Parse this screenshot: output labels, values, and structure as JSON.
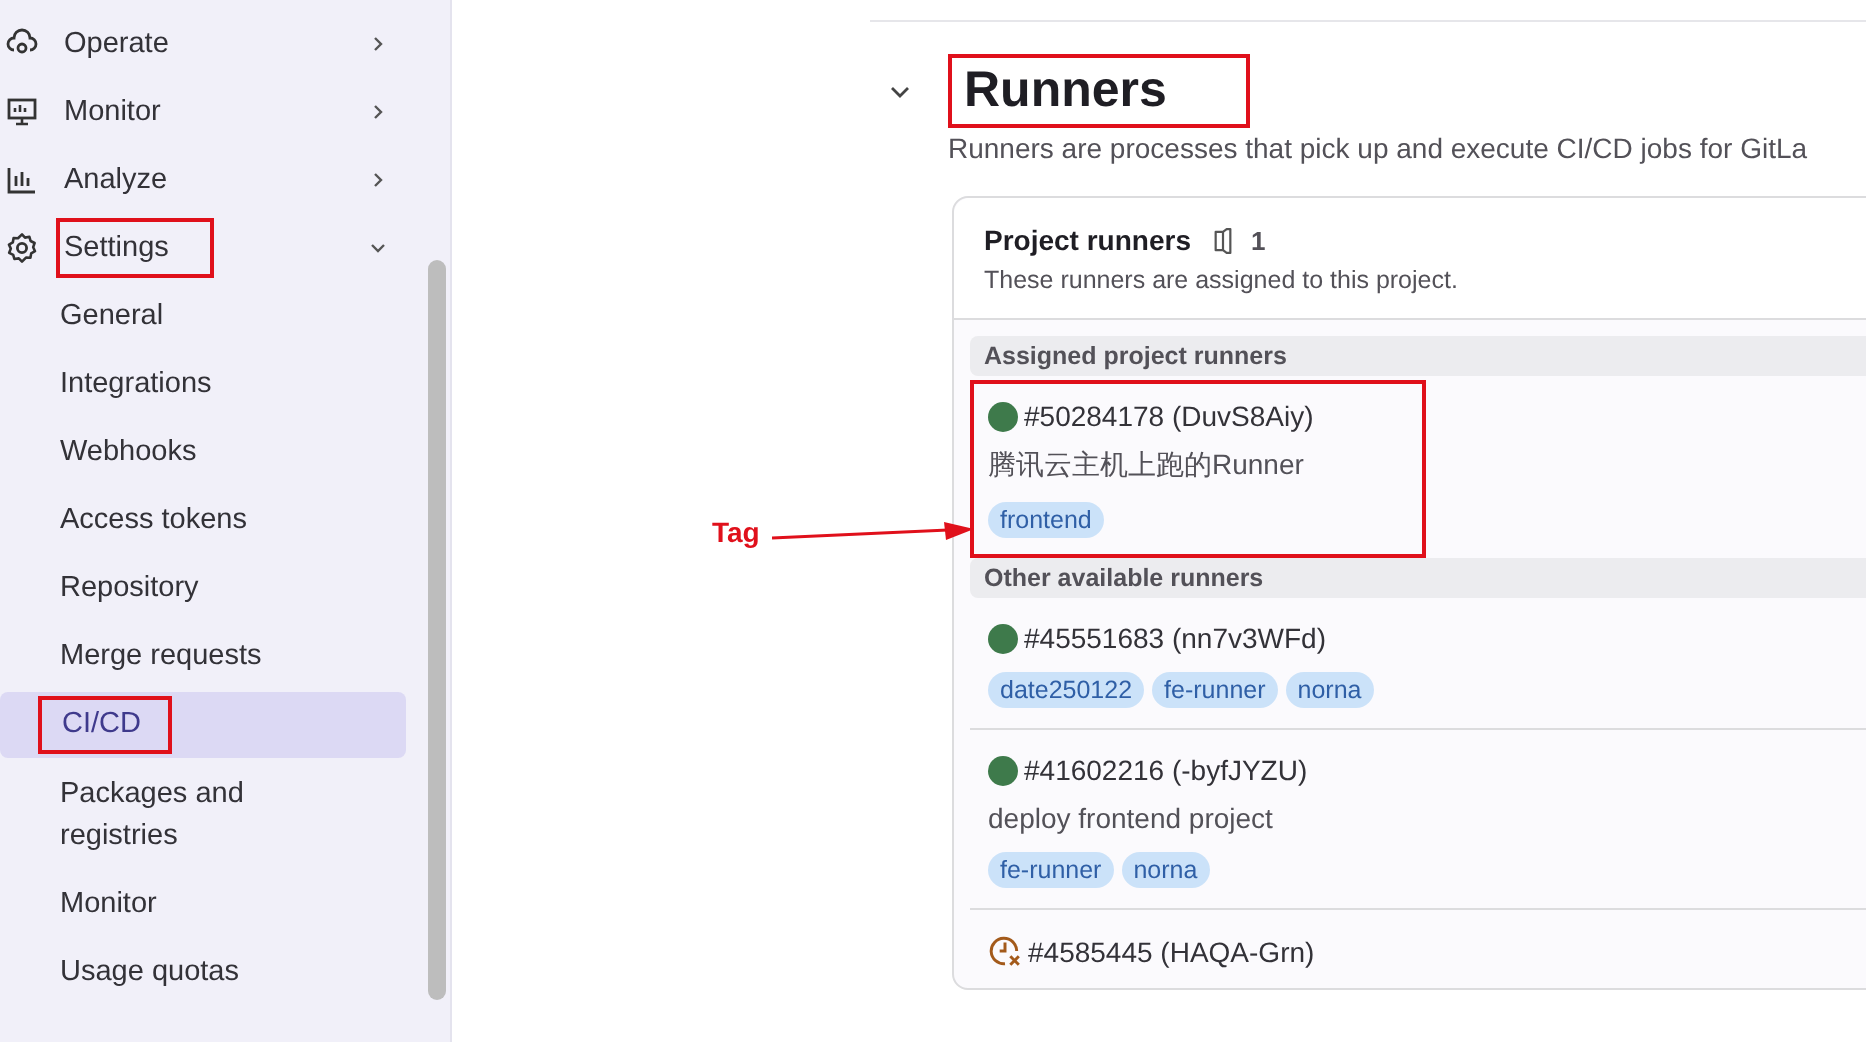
{
  "sidebar": {
    "items": [
      {
        "label": "Operate",
        "kind": "operate",
        "expanded": false,
        "highlighted": false
      },
      {
        "label": "Monitor",
        "kind": "monitor",
        "expanded": false,
        "highlighted": false
      },
      {
        "label": "Analyze",
        "kind": "analyze",
        "expanded": false,
        "highlighted": false
      },
      {
        "label": "Settings",
        "kind": "settings",
        "expanded": true,
        "highlighted": true,
        "children": [
          {
            "label": "General",
            "selected": false,
            "highlighted": false
          },
          {
            "label": "Integrations",
            "selected": false,
            "highlighted": false
          },
          {
            "label": "Webhooks",
            "selected": false,
            "highlighted": false
          },
          {
            "label": "Access tokens",
            "selected": false,
            "highlighted": false
          },
          {
            "label": "Repository",
            "selected": false,
            "highlighted": false
          },
          {
            "label": "Merge requests",
            "selected": false,
            "highlighted": false
          },
          {
            "label": "CI/CD",
            "selected": true,
            "highlighted": true
          },
          {
            "label": "Packages and registries",
            "selected": false,
            "highlighted": false
          },
          {
            "label": "Monitor",
            "selected": false,
            "highlighted": false
          },
          {
            "label": "Usage quotas",
            "selected": false,
            "highlighted": false
          }
        ]
      }
    ]
  },
  "section": {
    "title": "Runners",
    "title_highlighted": true,
    "expanded": true,
    "description": "Runners are processes that pick up and execute CI/CD jobs for GitLa"
  },
  "card": {
    "title": "Project runners",
    "count": "1",
    "subtitle": "These runners are assigned to this project.",
    "groups": [
      {
        "label": "Assigned project runners",
        "runners": [
          {
            "name": "#50284178 (DuvS8Aiy)",
            "kind": "online",
            "description": "腾讯云主机上跑的Runner",
            "tags": [
              "frontend"
            ],
            "highlighted": true
          }
        ]
      },
      {
        "label": "Other available runners",
        "runners": [
          {
            "name": "#45551683 (nn7v3WFd)",
            "kind": "online",
            "tags": [
              "date250122",
              "fe-runner",
              "norna"
            ],
            "highlighted": false
          },
          {
            "name": "#41602216 (-byfJYZU)",
            "kind": "online",
            "description": "deploy frontend project",
            "tags": [
              "fe-runner",
              "norna"
            ],
            "highlighted": false
          },
          {
            "name": "#4585445 (HAQA-Grn)",
            "kind": "stale",
            "highlighted": false
          }
        ]
      }
    ]
  },
  "callout": {
    "label": "Tag"
  }
}
